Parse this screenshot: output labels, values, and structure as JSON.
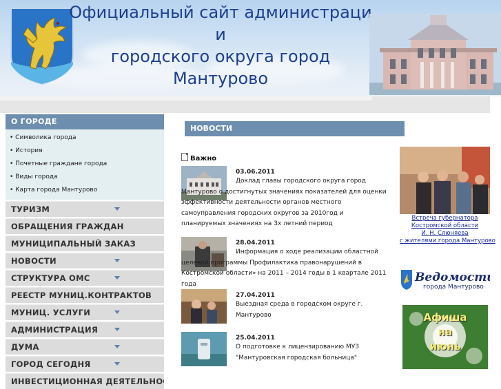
{
  "header": {
    "title_lines": [
      "Официальный сайт администраци",
      "и",
      "городского округа город",
      "Мантурово"
    ]
  },
  "left_nav": {
    "section_title": "О ГОРОДЕ",
    "sub_items": [
      "• Символика города",
      "• История",
      "• Почетные граждане города",
      "• Виды города",
      "• Карта города Мантурово"
    ],
    "menu": [
      {
        "label": "ТУРИЗМ",
        "has_arrow": true
      },
      {
        "label": "ОБРАЩЕНИЯ ГРАЖДАН",
        "has_arrow": false
      },
      {
        "label": "МУНИЦИПАЛЬНЫЙ ЗАКАЗ",
        "has_arrow": false
      },
      {
        "label": "НОВОСТИ",
        "has_arrow": true
      },
      {
        "label": "СТРУКТУРА ОМС",
        "has_arrow": true
      },
      {
        "label": "РЕЕСТР МУНИЦ.КОНТРАКТОВ",
        "has_arrow": false
      },
      {
        "label": "МУНИЦ. УСЛУГИ",
        "has_arrow": true
      },
      {
        "label": "АДМИНИСТРАЦИЯ",
        "has_arrow": true
      },
      {
        "label": "ДУМА",
        "has_arrow": true
      },
      {
        "label": "ГОРОД СЕГОДНЯ",
        "has_arrow": true
      },
      {
        "label": "ИНВЕСТИЦИОННАЯ ДЕЯТЕЛЬНОСТ",
        "has_arrow": false
      }
    ]
  },
  "news": {
    "section_title": "НОВОСТИ",
    "important_label": "Важно",
    "items": [
      {
        "date": "03.06.2011",
        "text": "Доклад главы городского округа город Мантурово о достигнутых значениях показателей для оценки эффективности деятельности органов местного самоуправления городских округов за  2010год и планируемых значениях на  3х летний период"
      },
      {
        "date": "28.04.2011",
        "text": "Информация о ходе реализации областной целевой программы   Профилактика правонарушений в Костромской области» на 2011 – 2014 годы в 1 квартале 2011 года"
      },
      {
        "date": "27.04.2011",
        "text": "Выездная среда в городском округе г. Мантурово"
      },
      {
        "date": "25.04.2011",
        "text": "О подготовке к лицензированию МУЗ \"Мантуровская городская больница\""
      }
    ]
  },
  "sidebar_right": {
    "caption_lines": [
      "Встреча губернатора",
      "Костромской области",
      "И. Н. Слюняева",
      "с жителями города Мантурово"
    ],
    "vedomosti_title": "Ведомости",
    "vedomosti_subtitle": "города Мантурово",
    "afisha_lines": [
      "Афиша",
      "на",
      "июнь"
    ]
  },
  "colors": {
    "title_blue": "#1d3f8f",
    "nav_header": "#6d8eae",
    "menu_gray": "#dcdcdc",
    "submenu_bg": "#e3eff1",
    "caption_link": "#1a2b9a",
    "afisha_text": "#f4ec7a"
  }
}
